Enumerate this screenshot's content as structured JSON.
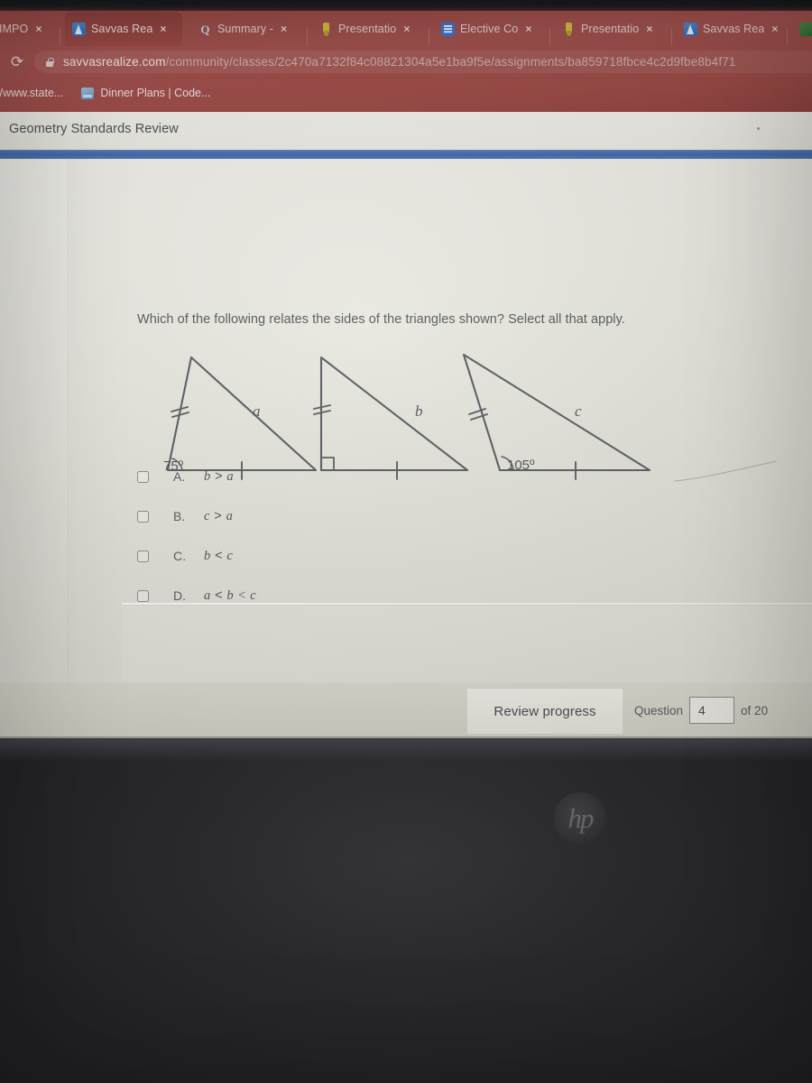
{
  "browser": {
    "tabs": [
      {
        "label": "*IMPO",
        "icon": "generic-page-icon",
        "active": false,
        "close": "×"
      },
      {
        "label": "Savvas Rea",
        "icon": "savvas-icon",
        "active": true,
        "close": "×"
      },
      {
        "label": "Summary -",
        "icon": "google-q-icon",
        "active": false,
        "close": "×"
      },
      {
        "label": "Presentatio",
        "icon": "google-slides-icon",
        "active": false,
        "close": "×"
      },
      {
        "label": "Elective Co",
        "icon": "google-docs-icon",
        "active": false,
        "close": "×"
      },
      {
        "label": "Presentatio",
        "icon": "google-slides-icon",
        "active": false,
        "close": "×"
      },
      {
        "label": "Savvas Rea",
        "icon": "savvas-icon",
        "active": false,
        "close": "×"
      },
      {
        "label": "",
        "icon": "green-app-icon",
        "active": false,
        "close": ""
      }
    ],
    "reload_glyph": "⟳",
    "url": {
      "host": "savvasrealize.com",
      "path": "/community/classes/2c470a7132f84c08821304a5e1ba9f5e/assignments/ba859718fbce4c2d9fbe8b4f71"
    },
    "bookmarks": [
      {
        "label": "//www.state...",
        "icon": "none"
      },
      {
        "label": "Dinner Plans | Code...",
        "icon": "monitor-icon"
      }
    ]
  },
  "page": {
    "title": "Geometry Standards Review",
    "question": "Which of the following relates the sides of the triangles shown? Select all that apply.",
    "figure": {
      "triangles": [
        {
          "side_label": "a",
          "angle_label": "75º",
          "marker": "double-tick",
          "right_angle": false
        },
        {
          "side_label": "b",
          "angle_label": "",
          "marker": "double-tick",
          "right_angle": true
        },
        {
          "side_label": "c",
          "angle_label": "105º",
          "marker": "double-tick",
          "right_angle": false
        }
      ]
    },
    "choices": [
      {
        "letter": "A.",
        "left": "b",
        "op": " > ",
        "right": "a",
        "checked": false
      },
      {
        "letter": "B.",
        "left": "c",
        "op": " > ",
        "right": "a",
        "checked": false
      },
      {
        "letter": "C.",
        "left": "b",
        "op": " < ",
        "right": "c",
        "checked": false
      },
      {
        "letter": "D.",
        "left": "a",
        "op": " < ",
        "right": "b < c",
        "checked": false
      }
    ]
  },
  "footer": {
    "review_label": "Review progress",
    "question_label": "Question",
    "question_number": "4",
    "of_label": "of 20"
  },
  "device": {
    "brand_logo": "hp"
  },
  "colors": {
    "chrome_red": "#9d4b47",
    "accent_blue": "#3f69ab",
    "page_bg": "#e9e8e0",
    "bezel": "#2c2c30"
  }
}
